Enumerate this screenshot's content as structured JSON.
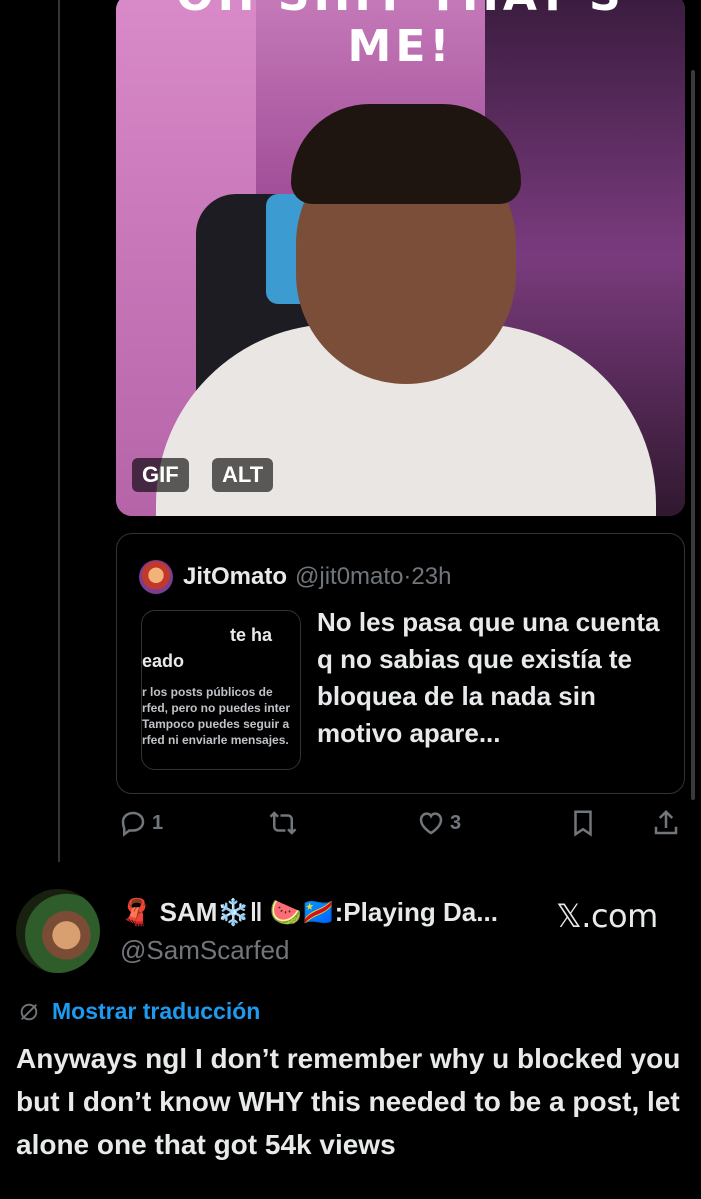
{
  "media": {
    "caption": "OH SHIT THAT'S ME!",
    "gif_label": "GIF",
    "alt_label": "ALT"
  },
  "quoted": {
    "name": "JitOmato",
    "handle": "@jit0mato",
    "separator": "·",
    "time": "23h",
    "thumbnail": {
      "line1": "te ha",
      "line2": "eado",
      "small": [
        "r los posts públicos de",
        "rfed, pero no puedes inter",
        "Tampoco puedes seguir a",
        "rfed ni enviarle mensajes."
      ]
    },
    "text": "No les pasa que una cuenta q no sabias que existía te bloquea de la nada sin motivo apare..."
  },
  "actions": {
    "replies": "1",
    "likes": "3"
  },
  "post": {
    "display_name": "🧣 SAM❄️‖ 🍉🇨🇩:Playing Da...",
    "source": "𝕏.com",
    "handle": "@SamScarfed",
    "translate_label": "Mostrar traducción",
    "text": "Anyways ngl I don’t remember why u blocked you but I don’t know WHY this needed to be a post, let alone one that got 54k views"
  },
  "colors": {
    "link": "#1d9bf0",
    "muted": "#71767b",
    "text": "#e7e9ea",
    "border": "#2f3336",
    "background": "#000000"
  },
  "icons": [
    "reply-icon",
    "retweet-icon",
    "like-icon",
    "bookmark-icon",
    "share-icon",
    "globe-slash-icon"
  ]
}
